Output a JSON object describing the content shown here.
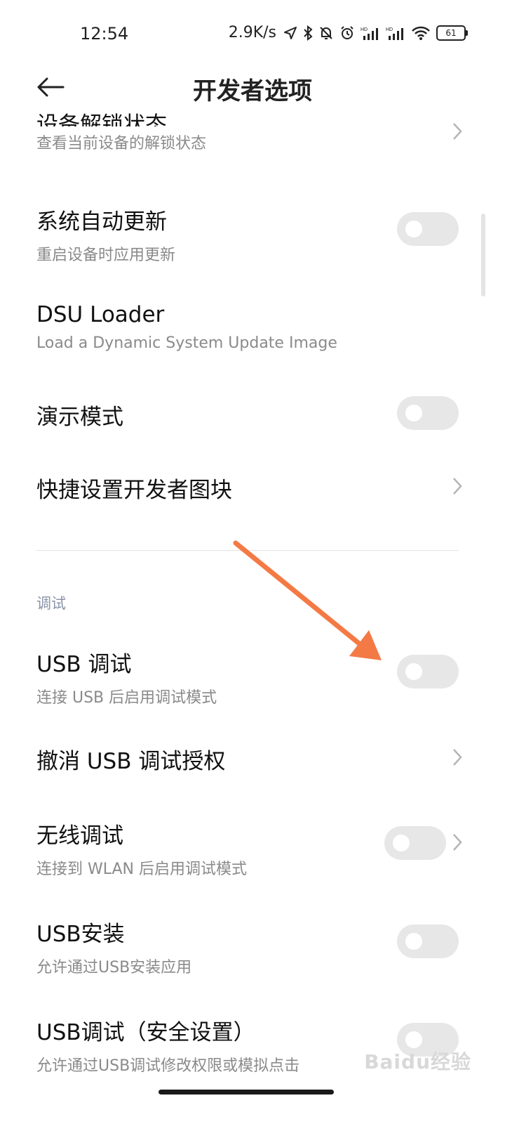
{
  "status": {
    "time": "12:54",
    "net_speed": "2.9K/s",
    "battery": "61"
  },
  "header": {
    "title": "开发者选项"
  },
  "items": [
    {
      "title": "设备解锁状态",
      "subtitle": "查看当前设备的解锁状态",
      "control": "chevron"
    },
    {
      "title": "系统自动更新",
      "subtitle": "重启设备时应用更新",
      "control": "toggle",
      "on": false
    },
    {
      "title": "DSU Loader",
      "subtitle": "Load a Dynamic System Update Image",
      "control": "none"
    },
    {
      "title": "演示模式",
      "subtitle": "",
      "control": "toggle",
      "on": false
    },
    {
      "title": "快捷设置开发者图块",
      "subtitle": "",
      "control": "chevron"
    }
  ],
  "section": {
    "label": "调试",
    "items": [
      {
        "title": "USB 调试",
        "subtitle": "连接 USB 后启用调试模式",
        "control": "toggle",
        "on": false
      },
      {
        "title": "撤消 USB 调试授权",
        "subtitle": "",
        "control": "chevron"
      },
      {
        "title": "无线调试",
        "subtitle": "连接到 WLAN 后启用调试模式",
        "control": "toggle-chevron",
        "on": false
      },
      {
        "title": "USB安装",
        "subtitle": "允许通过USB安装应用",
        "control": "toggle",
        "on": false
      },
      {
        "title": "USB调试（安全设置）",
        "subtitle": "允许通过USB调试修改权限或模拟点击",
        "control": "toggle",
        "on": false
      }
    ]
  },
  "watermark": "Baidu经验",
  "colors": {
    "annotation_arrow": "#f47a45",
    "toggle_off": "#e7e7e7",
    "section_label": "#8a93a8"
  },
  "icons": [
    "back-arrow-icon",
    "location-icon",
    "bluetooth-icon",
    "mute-icon",
    "alarm-icon",
    "signal-icon",
    "wifi-icon",
    "battery-icon",
    "chevron-right-icon"
  ]
}
